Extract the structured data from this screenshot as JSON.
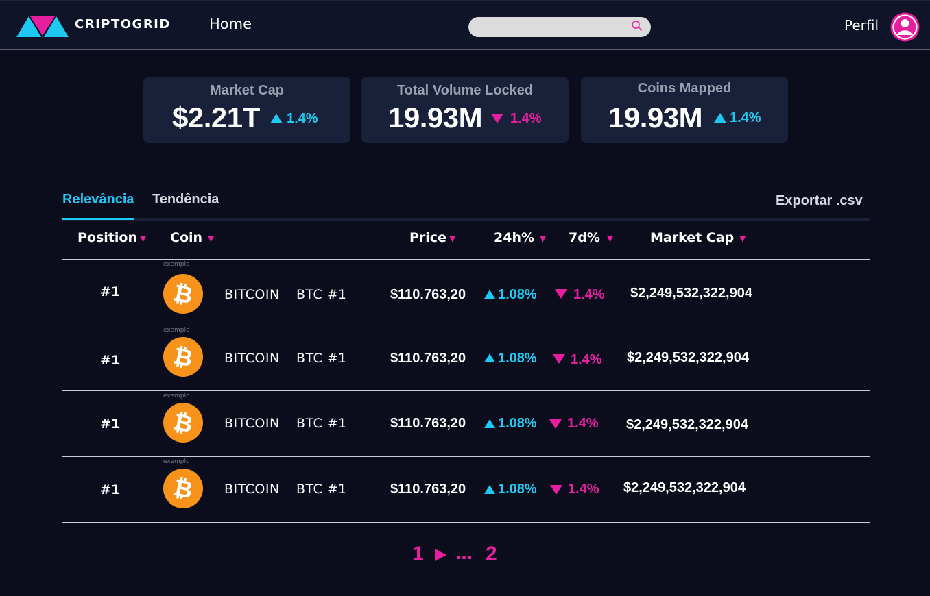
{
  "header": {
    "brand": "CRIPTOGRID",
    "nav_home": "Home",
    "search_placeholder": "",
    "profile_label": "Perfil",
    "logo_icon": "criptogrid-triangles-logo",
    "search_icon": "search-icon",
    "avatar_icon": "user-avatar-icon"
  },
  "stats": [
    {
      "label": "Market Cap",
      "value": "$2.21T",
      "change": "1.4%",
      "direction": "up"
    },
    {
      "label": "Total Volume Locked",
      "value": "19.93M",
      "change": "1.4%",
      "direction": "down"
    },
    {
      "label": "Coins Mapped",
      "value": "19.93M",
      "change": "1.4%",
      "direction": "up"
    }
  ],
  "tabs": {
    "relevance": "Relevância",
    "trend": "Tendência",
    "active": "relevance",
    "export": "Exportar .csv"
  },
  "table": {
    "headers": {
      "position": "Position",
      "coin": "Coin",
      "price": "Price",
      "change_24h": "24h%",
      "change_7d": "7d%",
      "market_cap": "Market Cap"
    },
    "sort_caret": "▼",
    "rows": [
      {
        "example_tag": "exemplo",
        "position": "#1",
        "coin_icon": "bitcoin-icon",
        "name": "BITCOIN",
        "symbol": "BTC",
        "rank": "#1",
        "price": "$110.763,20",
        "change_24h": "1.08%",
        "change_24h_dir": "up",
        "change_7d": "1.4%",
        "change_7d_dir": "down",
        "market_cap": "$2,249,532,322,904"
      },
      {
        "example_tag": "exemplo",
        "position": "#1",
        "coin_icon": "bitcoin-icon",
        "name": "BITCOIN",
        "symbol": "BTC",
        "rank": "#1",
        "price": "$110.763,20",
        "change_24h": "1.08%",
        "change_24h_dir": "up",
        "change_7d": "1.4%",
        "change_7d_dir": "down",
        "market_cap": "$2,249,532,322,904"
      },
      {
        "example_tag": "exemplo",
        "position": "#1",
        "coin_icon": "bitcoin-icon",
        "name": "BITCOIN",
        "symbol": "BTC",
        "rank": "#1",
        "price": "$110.763,20",
        "change_24h": "1.08%",
        "change_24h_dir": "up",
        "change_7d": "1.4%",
        "change_7d_dir": "down",
        "market_cap": "$2,249,532,322,904"
      },
      {
        "example_tag": "exemplo",
        "position": "#1",
        "coin_icon": "bitcoin-icon",
        "name": "BITCOIN",
        "symbol": "BTC",
        "rank": "#1",
        "price": "$110.763,20",
        "change_24h": "1.08%",
        "change_24h_dir": "up",
        "change_7d": "1.4%",
        "change_7d_dir": "down",
        "market_cap": "$2,249,532,322,904"
      }
    ]
  },
  "pagination": {
    "current": "1",
    "next_icon": "play-arrow-icon",
    "ellipsis": "...",
    "last": "2"
  },
  "colors": {
    "background": "#0b0d1d",
    "topbar": "#0f1428",
    "card": "#18203a",
    "accent_cyan": "#1ec8f0",
    "accent_magenta": "#e81ea0",
    "bitcoin_orange": "#f7931a"
  }
}
